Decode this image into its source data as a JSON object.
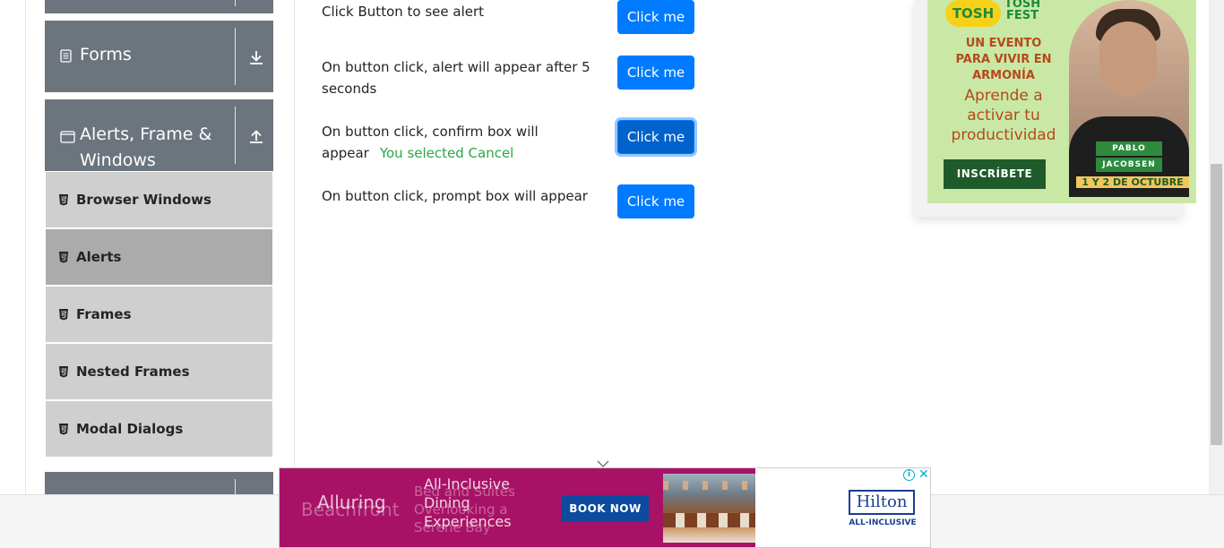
{
  "sidebar": {
    "groups": [
      {
        "title": ""
      },
      {
        "title": "Forms",
        "icon": "document-icon",
        "arrow": "download-arrow-icon"
      },
      {
        "title_line1": "Alerts, Frame &",
        "title_line2": "Windows",
        "icon": "window-icon",
        "arrow": "upload-arrow-icon"
      },
      {
        "title": ""
      }
    ],
    "items": [
      {
        "label": "Browser Windows",
        "active": false
      },
      {
        "label": "Alerts",
        "active": true
      },
      {
        "label": "Frames",
        "active": false
      },
      {
        "label": "Nested Frames",
        "active": false
      },
      {
        "label": "Modal Dialogs",
        "active": false
      }
    ]
  },
  "main": {
    "rows": [
      {
        "text": "Click Button to see alert",
        "button": "Click me"
      },
      {
        "text_line1": "On button click, alert will appear after 5",
        "text_line2": "seconds",
        "button": "Click me"
      },
      {
        "text_line1": "On button click, confirm box will",
        "text_line2": "appear",
        "result": "You selected Cancel",
        "button": "Click me"
      },
      {
        "text": "On button click, prompt box will appear",
        "button": "Click me"
      }
    ]
  },
  "ad_right": {
    "logo": "TOSH",
    "logo2_line1": "TOSH",
    "logo2_line2": "FEST",
    "headline_line1": "UN EVENTO",
    "headline_line2": "PARA VIVIR EN",
    "headline_line3": "ARMONÍA",
    "sub_line1": "Aprende a",
    "sub_line2": "activar tu",
    "sub_line3": "productividad",
    "cta": "INSCRÍBETE",
    "name1": "PABLO",
    "name2": "JACOBSEN",
    "date": "1 Y 2 DE OCTUBRE"
  },
  "ad_bottom": {
    "ghost1": "Beachfront",
    "ghost2_line1": "Bed and Suites",
    "ghost2_line2": "Overlooking a",
    "ghost2_line3": "Serene Bay",
    "brand_word": "Alluring",
    "copy_line1": "All-Inclusive",
    "copy_line2": "Dining",
    "copy_line3": "Experiences",
    "cta": "BOOK NOW",
    "logo": "Hilton",
    "logo_sub": "ALL-INCLUSIVE",
    "info": "i",
    "close": "✕"
  },
  "colors": {
    "primary_button": "#007bff",
    "sidebar_group": "#6c757d",
    "sidebar_item": "#cfcfcf",
    "sidebar_item_active": "#ababab",
    "success_text": "#28a745"
  }
}
